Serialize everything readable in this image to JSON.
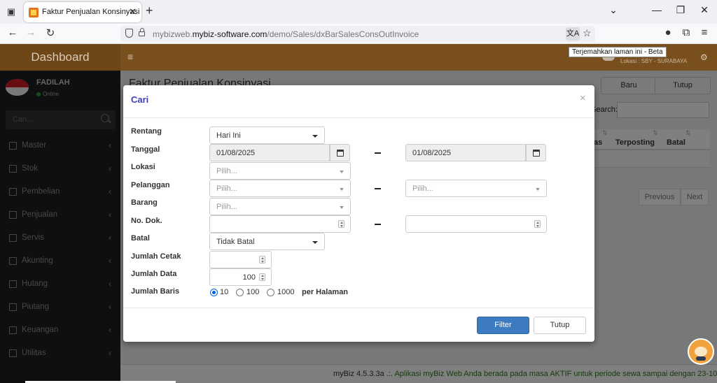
{
  "browser": {
    "tab_title": "Faktur Penjualan Konsinyasi",
    "url_prefix": "mybizweb.",
    "url_domain": "mybiz-software.com",
    "url_path": "/demo/Sales/dxBarSalesConsOutInvoice",
    "translate_tooltip": "Terjemahkan laman ini - Beta"
  },
  "app": {
    "brand": "Dashboard",
    "location": "Lokasi : SBY - SURABAYA",
    "user_name": "FADILAH",
    "user_status": "Online",
    "search_placeholder": "Cari...",
    "menu": [
      {
        "label": "Master"
      },
      {
        "label": "Stok"
      },
      {
        "label": "Pembelian"
      },
      {
        "label": "Penjualan"
      },
      {
        "label": "Servis"
      },
      {
        "label": "Akunting"
      },
      {
        "label": "Hutang"
      },
      {
        "label": "Piutang"
      },
      {
        "label": "Keuangan"
      },
      {
        "label": "Utilitas"
      }
    ]
  },
  "page": {
    "title": "Faktur Penjualan Konsinyasi",
    "btn_new": "Baru",
    "btn_close": "Tutup",
    "search_label": "Search:",
    "columns": [
      "as",
      "Terposting",
      "Batal"
    ],
    "pager_prev": "Previous",
    "pager_next": "Next"
  },
  "footer": {
    "version": "myBiz 4.5.3.3a",
    "separator": " .:. ",
    "message": "Aplikasi myBiz Web Anda berada pada masa AKTIF untuk periode sewa sampai dengan 23-10"
  },
  "modal": {
    "title": "Cari",
    "labels": {
      "rentang": "Rentang",
      "tanggal": "Tanggal",
      "lokasi": "Lokasi",
      "pelanggan": "Pelanggan",
      "barang": "Barang",
      "no_dok": "No. Dok.",
      "batal": "Batal",
      "jumlah_cetak": "Jumlah Cetak",
      "jumlah_data": "Jumlah Data",
      "jumlah_baris": "Jumlah Baris"
    },
    "rentang_value": "Hari Ini",
    "tanggal_from": "01/08/2025",
    "tanggal_to": "01/08/2025",
    "pilih_placeholder": "Pilih...",
    "batal_value": "Tidak Batal",
    "jumlah_data_value": "100",
    "baris_options": [
      "10",
      "100",
      "1000"
    ],
    "baris_selected": "10",
    "baris_suffix": "per Halaman",
    "btn_filter": "Filter",
    "btn_tutup": "Tutup"
  },
  "colors": {
    "header_brown": "#7a4f1e",
    "sidebar_dark": "#1c1f21",
    "primary_blue": "#3c7bc0",
    "modal_title": "#3c3cb8"
  }
}
